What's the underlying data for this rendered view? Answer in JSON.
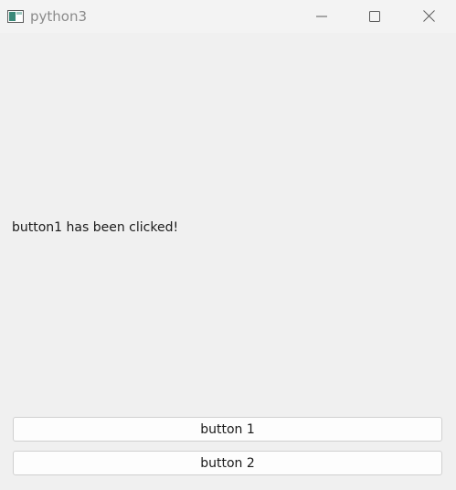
{
  "window": {
    "title": "python3"
  },
  "main": {
    "message": "button1 has been clicked!",
    "buttons": [
      {
        "label": "button 1"
      },
      {
        "label": "button 2"
      }
    ]
  },
  "icons": {
    "app": "app-window-icon",
    "minimize": "minimize-icon",
    "maximize": "maximize-icon",
    "close": "close-icon"
  },
  "colors": {
    "background": "#f0f0f0",
    "titlebar": "#f3f3f3",
    "title_text": "#8b8b8b",
    "button_bg": "#fdfdfd",
    "button_border": "#d0d0d0"
  }
}
